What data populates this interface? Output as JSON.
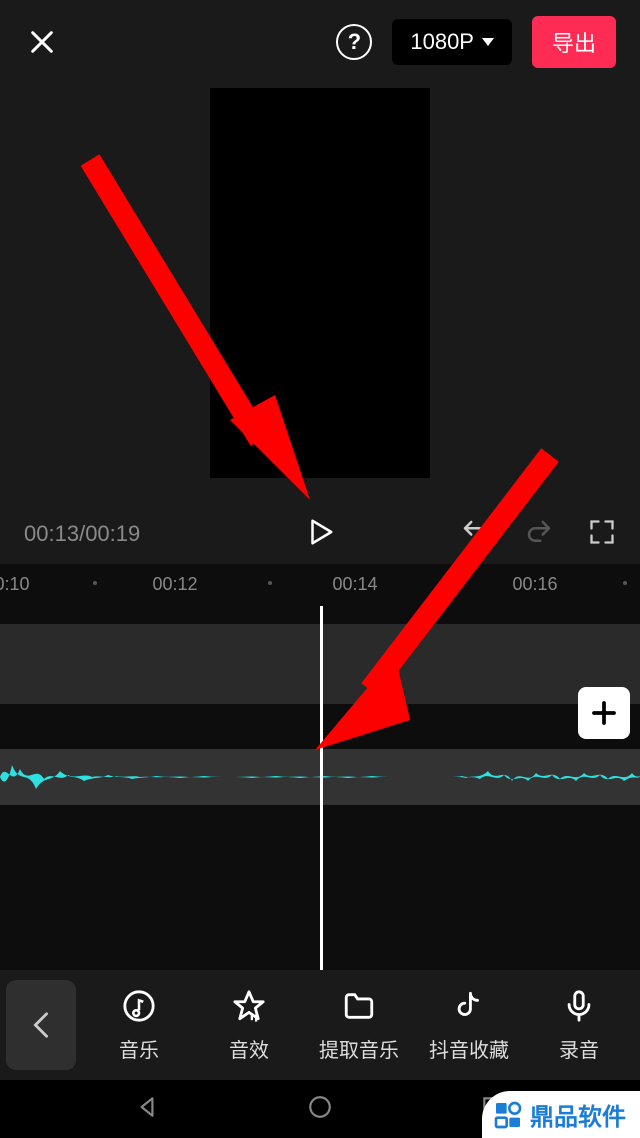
{
  "topbar": {
    "resolution": "1080P",
    "export_label": "导出"
  },
  "player": {
    "current_time": "00:13",
    "total_time": "00:19"
  },
  "ruler": {
    "labels": [
      "0:10",
      "00:12",
      "00:14",
      "00:16"
    ]
  },
  "tools": {
    "music": "音乐",
    "sfx": "音效",
    "extract": "提取音乐",
    "favorite": "抖音收藏",
    "record": "录音"
  },
  "watermark": {
    "text": "鼎品软件"
  },
  "icons": {
    "close": "close-icon",
    "help": "help-icon",
    "play": "play-icon",
    "undo": "undo-icon",
    "redo": "redo-icon",
    "fullscreen": "fullscreen-icon",
    "plus": "plus-icon",
    "back": "back-icon",
    "nav_back": "nav-back-icon",
    "nav_home": "nav-home-icon",
    "nav_recent": "nav-recent-icon"
  },
  "colors": {
    "accent": "#FE2C55",
    "waveform": "#2DE1E1",
    "arrow": "#FF0000"
  }
}
